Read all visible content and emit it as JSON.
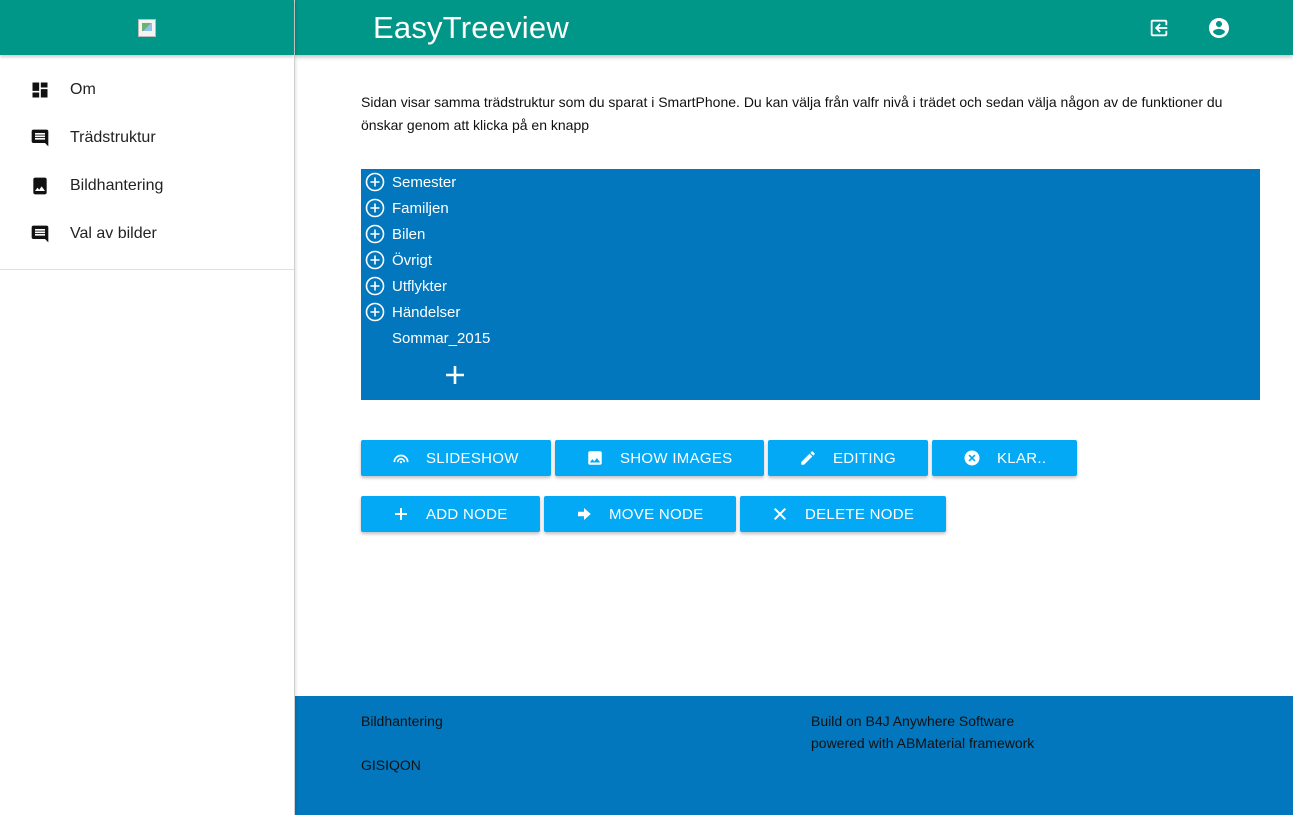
{
  "header": {
    "title": "EasyTreeview",
    "login_icon": "login-icon",
    "account_icon": "account-circle-icon"
  },
  "sidebar": {
    "items": [
      {
        "label": "Om",
        "icon": "dashboard-icon"
      },
      {
        "label": "Trädstruktur",
        "icon": "comment-icon"
      },
      {
        "label": "Bildhantering",
        "icon": "photo-album-icon"
      },
      {
        "label": "Val av bilder",
        "icon": "comment-icon"
      }
    ]
  },
  "main": {
    "intro": "Sidan visar samma trädstruktur som du sparat i SmartPhone. Du kan välja från valfr nivå i trädet och sedan välja någon av de funktioner du önskar genom att klicka på en knapp",
    "tree": {
      "nodes": [
        {
          "label": "Semester",
          "expandable": true
        },
        {
          "label": "Familjen",
          "expandable": true
        },
        {
          "label": "Bilen",
          "expandable": true
        },
        {
          "label": "Övrigt",
          "expandable": true
        },
        {
          "label": "Utflykter",
          "expandable": true
        },
        {
          "label": "Händelser",
          "expandable": true
        },
        {
          "label": "Sommar_2015",
          "expandable": false
        }
      ]
    },
    "buttons_row1": [
      {
        "label": "SLIDESHOW",
        "icon": "slideshow-icon"
      },
      {
        "label": "SHOW IMAGES",
        "icon": "image-icon"
      },
      {
        "label": "EDITING",
        "icon": "pencil-icon"
      },
      {
        "label": "KLAR..",
        "icon": "cancel-icon"
      }
    ],
    "buttons_row2": [
      {
        "label": "ADD NODE",
        "icon": "plus-icon"
      },
      {
        "label": "MOVE NODE",
        "icon": "arrow-right-icon"
      },
      {
        "label": "DELETE NODE",
        "icon": "close-icon"
      }
    ]
  },
  "footer": {
    "left_line1": "Bildhantering",
    "left_line2": "GISIQON",
    "right_line1": "Build on B4J Anywhere Software",
    "right_line2": "powered with ABMaterial framework"
  },
  "colors": {
    "primary": "#009688",
    "tree_bg": "#0277bd",
    "button": "#03a9f4",
    "footer": "#0277bd"
  }
}
